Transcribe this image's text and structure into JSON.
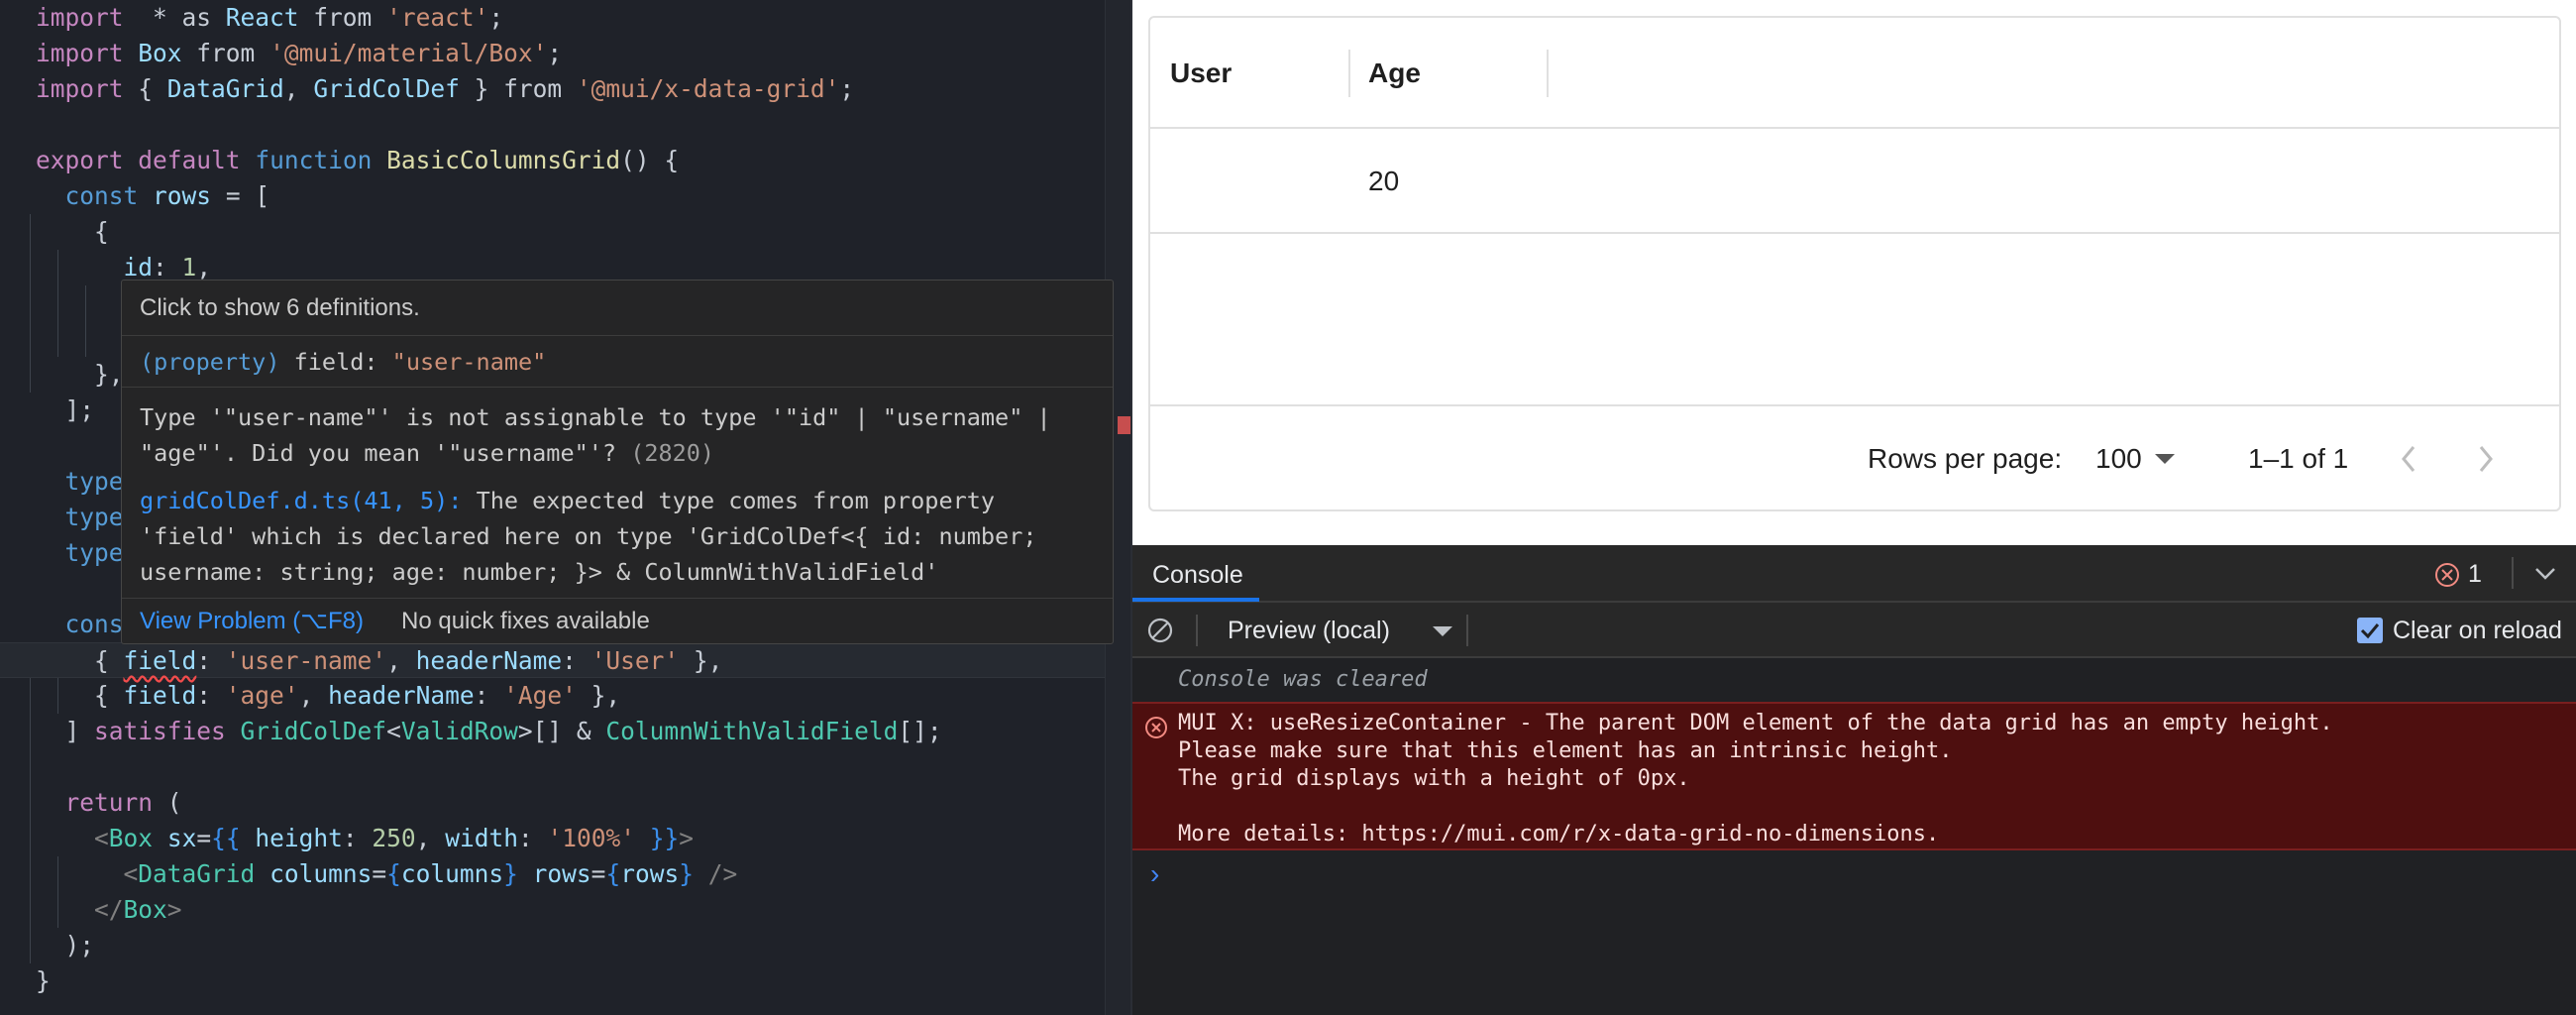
{
  "editor": {
    "lines": [
      {
        "segs": [
          [
            "k",
            "import"
          ],
          [
            "",
            "  * as "
          ],
          [
            "v",
            "React"
          ],
          [
            "",
            " from "
          ],
          [
            "s",
            "'react'"
          ],
          [
            "",
            ";"
          ]
        ]
      },
      {
        "segs": [
          [
            "k",
            "import"
          ],
          [
            "",
            " "
          ],
          [
            "v",
            "Box"
          ],
          [
            "",
            " from "
          ],
          [
            "s",
            "'@mui/material/Box'"
          ],
          [
            "",
            ";"
          ]
        ]
      },
      {
        "segs": [
          [
            "k",
            "import"
          ],
          [
            "",
            " { "
          ],
          [
            "v",
            "DataGrid"
          ],
          [
            "",
            ", "
          ],
          [
            "v",
            "GridColDef"
          ],
          [
            "",
            " } from "
          ],
          [
            "s",
            "'@mui/x-data-grid'"
          ],
          [
            "",
            ";"
          ]
        ]
      },
      {
        "segs": []
      },
      {
        "segs": [
          [
            "k",
            "export"
          ],
          [
            "",
            " "
          ],
          [
            "k",
            "default"
          ],
          [
            "",
            " "
          ],
          [
            "b",
            "function"
          ],
          [
            "",
            " "
          ],
          [
            "f",
            "BasicColumnsGrid"
          ],
          [
            "",
            "() {"
          ]
        ]
      },
      {
        "segs": [
          [
            "",
            "  "
          ],
          [
            "b",
            "const"
          ],
          [
            "",
            " "
          ],
          [
            "v",
            "rows"
          ],
          [
            "",
            " = ["
          ]
        ]
      },
      {
        "segs": [
          [
            "",
            "    {"
          ]
        ]
      },
      {
        "segs": [
          [
            "",
            "      "
          ],
          [
            "v",
            "id"
          ],
          [
            "",
            ": "
          ],
          [
            "n",
            "1"
          ],
          [
            "",
            ","
          ]
        ]
      },
      {
        "segs": []
      },
      {
        "segs": []
      },
      {
        "segs": [
          [
            "",
            "    },"
          ]
        ]
      },
      {
        "segs": [
          [
            "",
            "  ];"
          ]
        ]
      },
      {
        "segs": []
      },
      {
        "segs": [
          [
            "",
            "  "
          ],
          [
            "b",
            "type"
          ]
        ]
      },
      {
        "segs": [
          [
            "",
            "  "
          ],
          [
            "b",
            "type"
          ]
        ]
      },
      {
        "segs": [
          [
            "",
            "  "
          ],
          [
            "b",
            "type"
          ]
        ]
      },
      {
        "segs": []
      },
      {
        "segs": [
          [
            "",
            "  "
          ],
          [
            "b",
            "cons"
          ]
        ]
      },
      {
        "segs": [
          [
            "",
            "    { "
          ],
          [
            "vsq",
            "field"
          ],
          [
            "",
            ": "
          ],
          [
            "s",
            "'user-name'"
          ],
          [
            "",
            ", "
          ],
          [
            "v",
            "headerName"
          ],
          [
            "",
            ": "
          ],
          [
            "s",
            "'User'"
          ],
          [
            "",
            " },"
          ]
        ],
        "current": true
      },
      {
        "segs": [
          [
            "",
            "    { "
          ],
          [
            "v",
            "field"
          ],
          [
            "",
            ": "
          ],
          [
            "s",
            "'age'"
          ],
          [
            "",
            ", "
          ],
          [
            "v",
            "headerName"
          ],
          [
            "",
            ": "
          ],
          [
            "s",
            "'Age'"
          ],
          [
            "",
            " },"
          ]
        ]
      },
      {
        "segs": [
          [
            "",
            "  ] "
          ],
          [
            "k",
            "satisfies"
          ],
          [
            "",
            " "
          ],
          [
            "t",
            "GridColDef"
          ],
          [
            "",
            "<"
          ],
          [
            "t",
            "ValidRow"
          ],
          [
            "",
            ">[] & "
          ],
          [
            "t",
            "ColumnWithValidField"
          ],
          [
            "",
            "[];"
          ]
        ]
      },
      {
        "segs": []
      },
      {
        "segs": [
          [
            "",
            "  "
          ],
          [
            "k",
            "return"
          ],
          [
            "",
            " ("
          ]
        ]
      },
      {
        "segs": [
          [
            "",
            "    "
          ],
          [
            "g",
            "<"
          ],
          [
            "tg",
            "Box"
          ],
          [
            "",
            " "
          ],
          [
            "v",
            "sx"
          ],
          [
            "",
            "="
          ],
          [
            "br",
            "{{"
          ],
          [
            "",
            " "
          ],
          [
            "v",
            "height"
          ],
          [
            "",
            ": "
          ],
          [
            "n",
            "250"
          ],
          [
            "",
            ", "
          ],
          [
            "v",
            "width"
          ],
          [
            "",
            ": "
          ],
          [
            "s",
            "'100%'"
          ],
          [
            "",
            " "
          ],
          [
            "br",
            "}}"
          ],
          [
            "g",
            ">"
          ]
        ]
      },
      {
        "segs": [
          [
            "",
            "      "
          ],
          [
            "g",
            "<"
          ],
          [
            "tg",
            "DataGrid"
          ],
          [
            "",
            " "
          ],
          [
            "v",
            "columns"
          ],
          [
            "",
            "="
          ],
          [
            "br",
            "{"
          ],
          [
            "v",
            "columns"
          ],
          [
            "br",
            "}"
          ],
          [
            "",
            " "
          ],
          [
            "v",
            "rows"
          ],
          [
            "",
            "="
          ],
          [
            "br",
            "{"
          ],
          [
            "v",
            "rows"
          ],
          [
            "br",
            "}"
          ],
          [
            "",
            " "
          ],
          [
            "g",
            "/>"
          ]
        ]
      },
      {
        "segs": [
          [
            "",
            "    "
          ],
          [
            "g",
            "</"
          ],
          [
            "tg",
            "Box"
          ],
          [
            "g",
            ">"
          ]
        ]
      },
      {
        "segs": [
          [
            "",
            "  );"
          ]
        ]
      },
      {
        "segs": [
          [
            "",
            "}"
          ]
        ]
      }
    ]
  },
  "hover": {
    "header": "Click to show 6 definitions.",
    "sig_prefix": "(property)",
    "sig_mid": " field: ",
    "sig_value": "\"user-name\"",
    "err_line1": "Type '\"user-name\"' is not assignable to type '\"id\" | \"username\" |",
    "err_line2": "\"age\"'. Did you mean '\"username\"'?",
    "err_code": " (2820)",
    "def_link": "gridColDef.d.ts(41, 5):",
    "def_line1": " The expected type comes from property",
    "def_line2": "'field' which is declared here on type 'GridColDef<{ id: number;",
    "def_line3": "username: string; age: number; }> & ColumnWithValidField'",
    "view_problem": "View Problem (⌥F8)",
    "no_fixes": "No quick fixes available"
  },
  "grid": {
    "columns": [
      "User",
      "Age"
    ],
    "row_age": "20",
    "rows_per_page_label": "Rows per page:",
    "rows_per_page_value": "100",
    "range": "1–1 of 1"
  },
  "console": {
    "tab": "Console",
    "error_count": "1",
    "context": "Preview (local)",
    "clear_on_reload": "Clear on reload",
    "cleared": "Console was cleared",
    "error_lines": [
      "MUI X: useResizeContainer - The parent DOM element of the data grid has an empty height.",
      "Please make sure that this element has an intrinsic height.",
      "The grid displays with a height of 0px.",
      "",
      "More details: https://mui.com/r/x-data-grid-no-dimensions."
    ]
  },
  "colors": {
    "error_bg": "#4e0f0f",
    "accent": "#1a73e8"
  }
}
